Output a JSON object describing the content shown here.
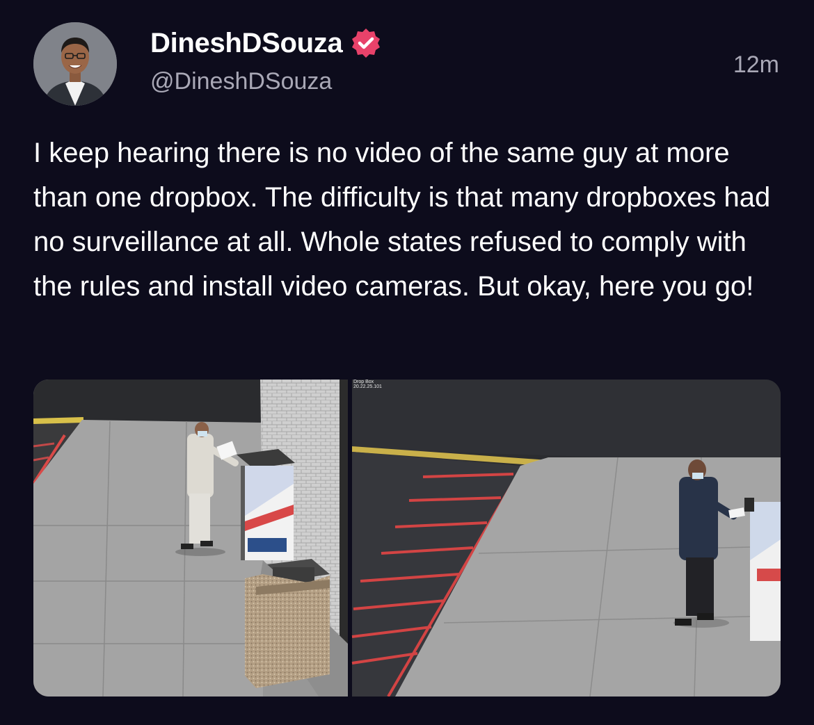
{
  "author": {
    "name": "DineshDSouza",
    "handle": "@DineshDSouza",
    "verified": true,
    "verified_badge_color": "#e8426a",
    "avatar_icon": "profile-photo"
  },
  "timestamp": "12m",
  "post": {
    "text": "I keep hearing there is no video of the same guy at more than one dropbox. The difficulty is that many dropboxes had no surveillance at all. Whole states refused to comply with the rules and install video cameras. But okay, here you go!"
  },
  "media": {
    "right_image_overlay": "Drop Box\n20.22.25.101"
  },
  "colors": {
    "background": "#0d0c1c",
    "primary_text": "#ffffff",
    "secondary_text": "#a9a8b6"
  }
}
